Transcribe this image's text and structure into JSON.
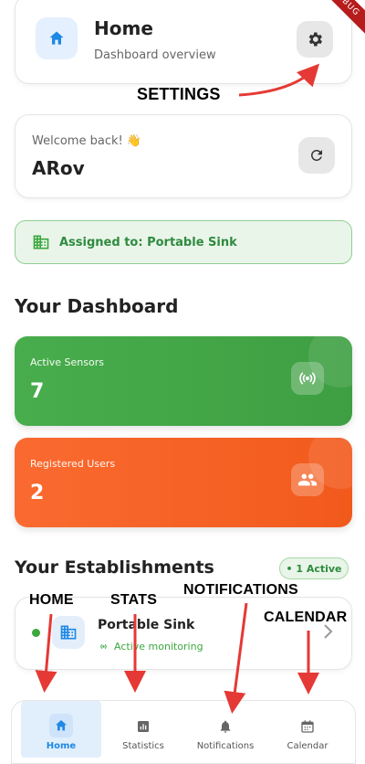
{
  "header": {
    "title": "Home",
    "subtitle": "Dashboard overview",
    "debug_banner": "DEBUG"
  },
  "welcome": {
    "greeting": "Welcome back! 👋",
    "name": "ARov"
  },
  "assigned": {
    "text": "Assigned to: Portable Sink"
  },
  "dashboard": {
    "title": "Your Dashboard",
    "cards": [
      {
        "label": "Active Sensors",
        "value": "7",
        "icon": "sensor-icon",
        "color": "#43a047"
      },
      {
        "label": "Registered Users",
        "value": "2",
        "icon": "users-icon",
        "color": "#f4511e"
      }
    ]
  },
  "establishments": {
    "title": "Your Establishments",
    "badge": "• 1 Active",
    "items": [
      {
        "name": "Portable Sink",
        "status": "Active monitoring"
      }
    ]
  },
  "nav": {
    "items": [
      {
        "label": "Home",
        "icon": "home-icon",
        "active": true
      },
      {
        "label": "Statistics",
        "icon": "statistics-icon",
        "active": false
      },
      {
        "label": "Notifications",
        "icon": "bell-icon",
        "active": false
      },
      {
        "label": "Calendar",
        "icon": "calendar-icon",
        "active": false
      }
    ]
  },
  "annotations": {
    "settings": "SETTINGS",
    "home": "HOME",
    "stats": "STATS",
    "notifications": "NOTIFICATIONS",
    "calendar": "CALENDAR"
  },
  "colors": {
    "primary_blue": "#1e88e5",
    "success_green": "#43a047",
    "warning_orange": "#f4511e",
    "arrow_red": "#e53935"
  }
}
